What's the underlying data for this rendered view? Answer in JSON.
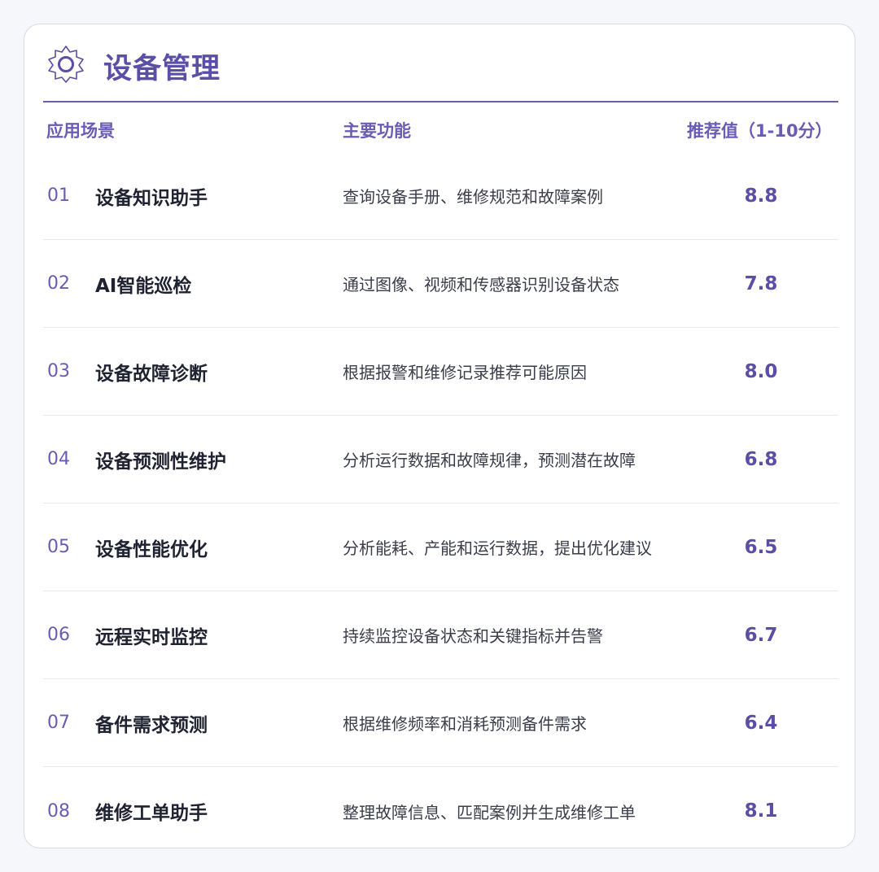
{
  "header": {
    "title": "设备管理",
    "icon": "gear-icon"
  },
  "columns": {
    "scenario": "应用场景",
    "function": "主要功能",
    "score": "推荐值（1-10分）"
  },
  "rows": [
    {
      "num": "01",
      "name": "设备知识助手",
      "desc": "查询设备手册、维修规范和故障案例",
      "score": "8.8"
    },
    {
      "num": "02",
      "name": "AI智能巡检",
      "desc": "通过图像、视频和传感器识别设备状态",
      "score": "7.8"
    },
    {
      "num": "03",
      "name": "设备故障诊断",
      "desc": "根据报警和维修记录推荐可能原因",
      "score": "8.0"
    },
    {
      "num": "04",
      "name": "设备预测性维护",
      "desc": "分析运行数据和故障规律，预测潜在故障",
      "score": "6.8"
    },
    {
      "num": "05",
      "name": "设备性能优化",
      "desc": "分析能耗、产能和运行数据，提出优化建议",
      "score": "6.5"
    },
    {
      "num": "06",
      "name": "远程实时监控",
      "desc": "持续监控设备状态和关键指标并告警",
      "score": "6.7"
    },
    {
      "num": "07",
      "name": "备件需求预测",
      "desc": "根据维修频率和消耗预测备件需求",
      "score": "6.4"
    },
    {
      "num": "08",
      "name": "维修工单助手",
      "desc": "整理故障信息、匹配案例并生成维修工单",
      "score": "8.1"
    }
  ],
  "colors": {
    "accent": "#5b4ea6",
    "text": "#1f2230",
    "divider": "#e8e9ef"
  }
}
